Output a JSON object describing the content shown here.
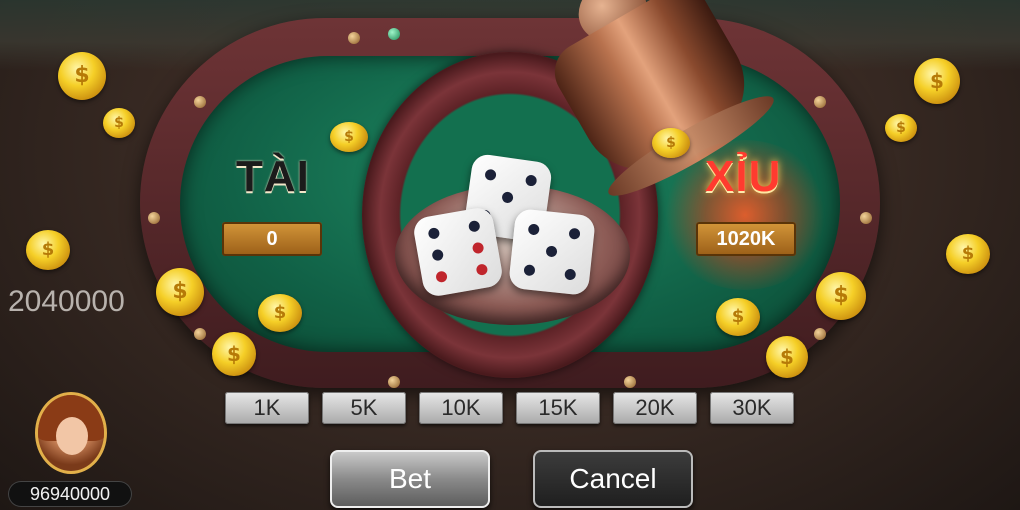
{
  "game": {
    "tai_label": "TÀI",
    "xiu_label": "XỈU",
    "tai_total": "0",
    "xiu_total": "1020K",
    "pot_amount": "2040000",
    "highlighted_side": "xiu"
  },
  "dice": [
    {
      "value": 5
    },
    {
      "value": 6
    },
    {
      "value": 5
    }
  ],
  "chips": [
    {
      "label": "1K"
    },
    {
      "label": "5K"
    },
    {
      "label": "10K"
    },
    {
      "label": "15K"
    },
    {
      "label": "20K"
    },
    {
      "label": "30K"
    }
  ],
  "actions": {
    "bet_label": "Bet",
    "cancel_label": "Cancel"
  },
  "player": {
    "avatar_icon": "player-avatar",
    "balance": "96940000"
  },
  "colors": {
    "felt": "#13704f",
    "rail": "#6e3436",
    "xiu_highlight": "#ff3b2f",
    "coin": "#f5cf27"
  },
  "icons": {
    "coin": "gold-coin-icon",
    "shaker": "dice-shaker-icon"
  }
}
